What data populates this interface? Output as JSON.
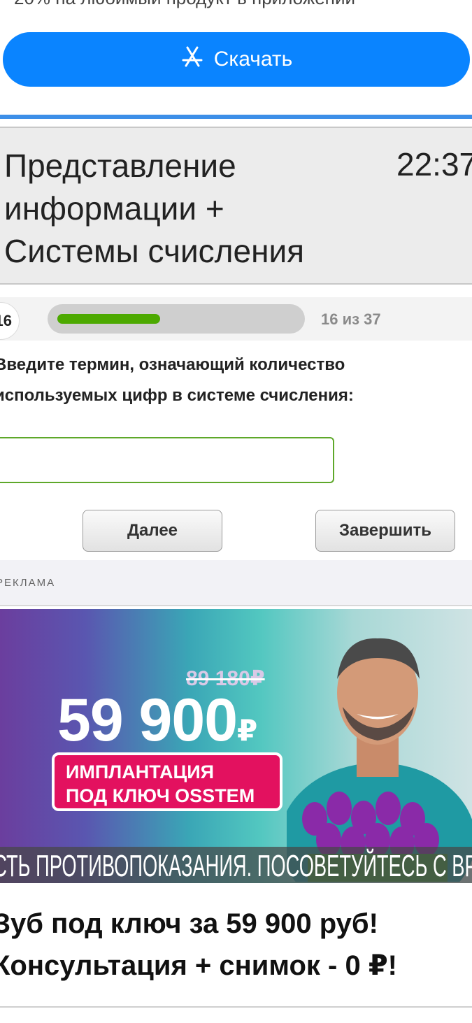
{
  "promo": {
    "text": "20% на любимый продукт в приложении",
    "download_label": "Скачать",
    "download_icon": "app-store-icon"
  },
  "quiz": {
    "title": "Представление информации + Системы счисления",
    "time": "22:37",
    "question_number": "16",
    "progress_text": "16 из 37",
    "progress_fraction": 0.4324,
    "question": "Введите термин, означающий количество используемых цифр в системе счисления:",
    "answer_value": "",
    "next_label": "Далее",
    "finish_label": "Завершить"
  },
  "ad": {
    "label": "РЕКЛАМА",
    "old_price": "89 180₽",
    "new_price": "59 900",
    "currency": "₽",
    "badge_line1": "ИМПЛАНТАЦИЯ",
    "badge_line2": "ПОД КЛЮЧ OSSTEM",
    "disclaimer": "ЕСТЬ ПРОТИВОПОКАЗАНИЯ. ПОСОВЕТУЙТЕСЬ С ВРАЧОМ",
    "headline": "Зуб под ключ за 59 900 руб! Консультация + снимок - 0 ₽!"
  },
  "colors": {
    "accent_blue": "#0a84ff",
    "progress_green": "#4ca900",
    "input_border": "#5ea82a",
    "ad_badge": "#e3115f"
  }
}
